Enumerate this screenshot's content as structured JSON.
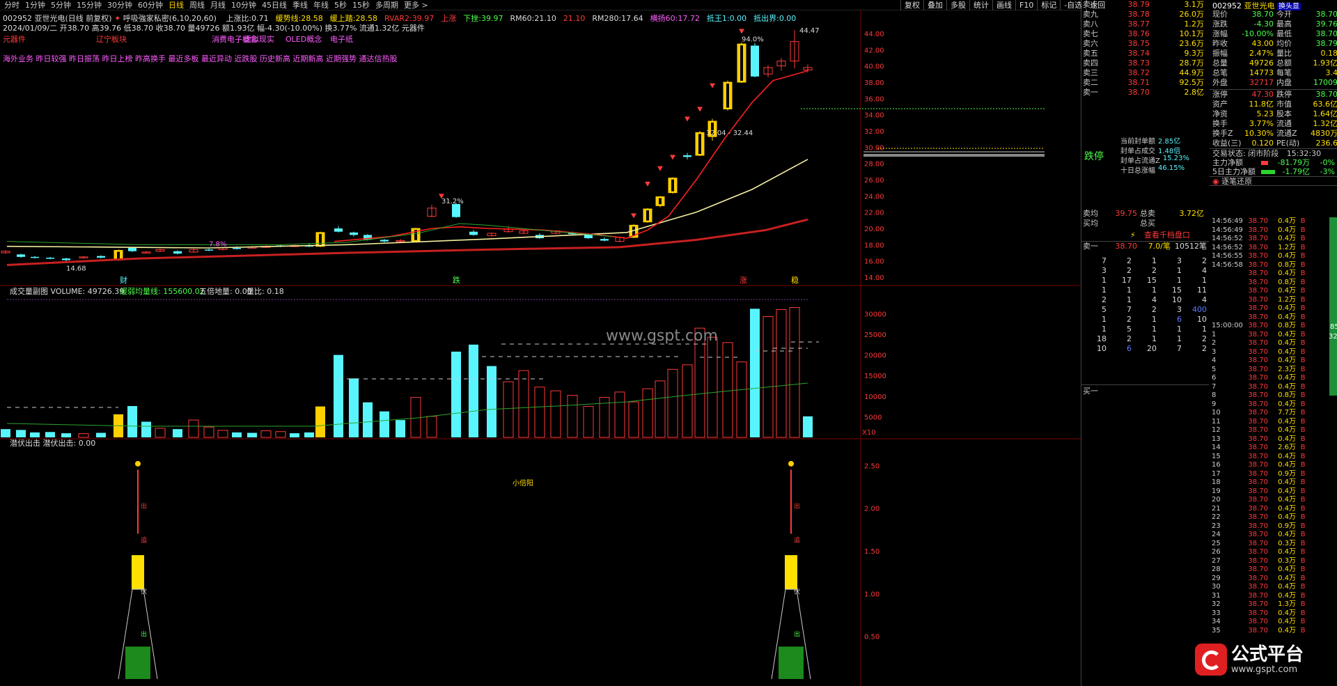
{
  "menu": {
    "periods": [
      "分时",
      "1分钟",
      "5分钟",
      "15分钟",
      "30分钟",
      "60分钟",
      "日线",
      "周线",
      "月线",
      "10分钟",
      "45日线",
      "季线",
      "年线",
      "5秒",
      "15秒",
      "多周期",
      "更多 >"
    ],
    "active": "日线",
    "tools": [
      "复权",
      "叠加",
      "多股",
      "统计",
      "画线",
      "F10",
      "标记",
      "-自选",
      "返回"
    ]
  },
  "header": {
    "code_name": "002952 亚世光电(日线 前复权)",
    "indicator": "呼吸強家私密(6,10,20,60)",
    "items": [
      {
        "label": "上涨比:",
        "value": "0.71",
        "c": "c-w"
      },
      {
        "label": "缓势线:",
        "value": "28.58",
        "c": "c-y"
      },
      {
        "label": "缓上踏:",
        "value": "28.58",
        "c": "c-y"
      },
      {
        "label": "RVAR2:",
        "value": "39.97",
        "c": "c-r"
      },
      {
        "label": "上涨",
        "value": "",
        "c": "c-r"
      },
      {
        "label": "下挫:",
        "value": "39.97",
        "c": "c-g"
      },
      {
        "label": "RM60:",
        "value": "21.10",
        "c": "c-w"
      },
      {
        "label": "",
        "value": "21.10",
        "c": "c-r"
      },
      {
        "label": "RM280:",
        "value": "17.64",
        "c": "c-w"
      },
      {
        "label": "横扬60:",
        "value": "17.72",
        "c": "c-m"
      },
      {
        "label": "抵王1:",
        "value": "0.00",
        "c": "c-c"
      },
      {
        "label": "抵出界:",
        "value": "0.00",
        "c": "c-c"
      }
    ],
    "line2": "2024/01/09/二 开38.70 高39.76 低38.70 收38.70 量49726 额1.93亿 幅-4.30(-10.00%) 换3.77% 流通1.32亿 元器件",
    "line3": [
      "元器件",
      "辽宁板块",
      "消费电子概念",
      "虚拟现实",
      "OLED概念",
      "电子纸"
    ],
    "line4": "海外业务 昨日较强 昨日振荡 昨日上榜 昨高换手 最近多板 最近异动 近跌股 历史新高 近期新高 近期强势 通达信热股"
  },
  "price_axis": [
    "44.00",
    "42.00",
    "40.00",
    "38.00",
    "36.00",
    "34.00",
    "32.00",
    "30.00",
    "28.00",
    "26.00",
    "24.00",
    "22.00",
    "20.00",
    "18.00",
    "16.00",
    "14.00"
  ],
  "annotations": {
    "top": "44.47",
    "pct1": "94.0%",
    "pct2": "31.2%",
    "pct3": "7.8%",
    "range": "32.04 - 32.44",
    "tags": [
      "财",
      "跌",
      "涨",
      "稳"
    ],
    "low": "14.68"
  },
  "volume": {
    "title": "成交量副图 VOLUME: 49726.39",
    "ma_label": "缓弱均量线: 155600.02",
    "five": "五倍地量: 0.00",
    "ratio": "量比: 0.18",
    "axis": [
      "30000",
      "25000",
      "20000",
      "15000",
      "10000",
      "5000"
    ],
    "unit": "X10",
    "note": "小倍阳"
  },
  "lower": {
    "title": "潜伏出击 潜伏出击: 0.00",
    "axis": [
      "2.50",
      "2.00",
      "1.50",
      "1.00",
      "0.50"
    ],
    "labels": [
      "出",
      "追",
      "伏",
      "出"
    ]
  },
  "orderbook": {
    "rows": [
      {
        "label": "卖十",
        "price": "38.79",
        "vol": "3.1万"
      },
      {
        "label": "卖九",
        "price": "38.78",
        "vol": "26.0万"
      },
      {
        "label": "卖八",
        "price": "38.77",
        "vol": "1.2万"
      },
      {
        "label": "卖七",
        "price": "38.76",
        "vol": "10.1万"
      },
      {
        "label": "卖六",
        "price": "38.75",
        "vol": "23.6万"
      },
      {
        "label": "卖五",
        "price": "38.74",
        "vol": "9.3万"
      },
      {
        "label": "卖四",
        "price": "38.73",
        "vol": "28.7万"
      },
      {
        "label": "卖三",
        "price": "38.72",
        "vol": "44.9万"
      },
      {
        "label": "卖二",
        "price": "38.71",
        "vol": "92.5万"
      },
      {
        "label": "卖一",
        "price": "38.70",
        "vol": "2.8亿"
      }
    ],
    "limit": "跌停",
    "seal": [
      {
        "l": "当前封单额",
        "v": "2.85亿"
      },
      {
        "l": "封单占成交",
        "v": "1.48倍"
      },
      {
        "l": "封单占流通Z",
        "v": "15.23%"
      },
      {
        "l": "十日总涨幅",
        "v": "46.15%"
      }
    ],
    "avg_sell_l": "卖均",
    "avg_sell": "39.75",
    "total_sell_l": "总卖",
    "total_sell": "3.72亿",
    "avg_buy_l": "买均",
    "total_buy_l": "总买",
    "view_btn": "查看千档盘口",
    "level_l": "卖一",
    "level_p": "38.70",
    "level_v": "7.0/笔",
    "level_n": "10512笔",
    "buy1": "买一"
  },
  "quote": {
    "code": "002952",
    "name": "亚世光电",
    "badge": "换头显",
    "rows": [
      [
        "现价",
        "38.70",
        "今开",
        "38.70"
      ],
      [
        "涨跌",
        "-4.30",
        "最高",
        "39.76"
      ],
      [
        "涨幅",
        "-10.00%",
        "最低",
        "38.70"
      ],
      [
        "昨收",
        "43.00",
        "均价",
        "38.79"
      ],
      [
        "振幅",
        "2.47%",
        "量比",
        "0.18"
      ],
      [
        "总量",
        "49726",
        "总额",
        "1.93亿"
      ],
      [
        "总笔",
        "14773",
        "每笔",
        "3.4"
      ],
      [
        "外盘",
        "32717",
        "内盘",
        "17009"
      ]
    ],
    "rows2": [
      [
        "涨停",
        "47.30",
        "跌停",
        "38.70"
      ],
      [
        "资产",
        "11.8亿",
        "市值",
        "63.6亿"
      ],
      [
        "净资",
        "5.23",
        "股本",
        "1.64亿"
      ],
      [
        "换手",
        "3.77%",
        "流通",
        "1.32亿"
      ],
      [
        "换手Z",
        "10.30%",
        "流通Z",
        "4830万"
      ],
      [
        "收益(三)",
        "0.120",
        "PE(动)",
        "236.6"
      ]
    ],
    "status": "交易状态: 闭市阶段",
    "time": "15:32:30",
    "flow1_l": "主力净额",
    "flow1": "-81.79万",
    "flow1p": "-0%",
    "flow2_l": "5日主力净额",
    "flow2": "-1.79亿",
    "flow2p": "-3%",
    "ticks_title": "逐笔还原"
  },
  "ticks": [
    [
      "14:56:49",
      "38.70",
      "0.4万",
      "B"
    ],
    [
      "14:56:49",
      "38.70",
      "0.4万",
      "B"
    ],
    [
      "14:56:52",
      "38.70",
      "0.4万",
      "B"
    ],
    [
      "14:56:52",
      "38.70",
      "1.2万",
      "B"
    ],
    [
      "14:56:55",
      "38.70",
      "0.4万",
      "B"
    ],
    [
      "14:56:58",
      "38.70",
      "0.8万",
      "B"
    ],
    [
      "",
      "38.70",
      "0.4万",
      "B"
    ],
    [
      "",
      "38.70",
      "0.8万",
      "B"
    ],
    [
      "",
      "38.70",
      "0.4万",
      "B"
    ],
    [
      "",
      "38.70",
      "1.2万",
      "B"
    ],
    [
      "",
      "38.70",
      "0.4万",
      "B"
    ],
    [
      "",
      "38.70",
      "0.4万",
      "B"
    ],
    [
      "15:00:00",
      "38.70",
      "0.8万",
      "B"
    ],
    [
      "1",
      "38.70",
      "0.4万",
      "B"
    ],
    [
      "2",
      "38.70",
      "0.4万",
      "B"
    ],
    [
      "3",
      "38.70",
      "0.4万",
      "B"
    ],
    [
      "4",
      "38.70",
      "0.4万",
      "B"
    ],
    [
      "5",
      "38.70",
      "2.3万",
      "B"
    ],
    [
      "6",
      "38.70",
      "0.4万",
      "B"
    ],
    [
      "7",
      "38.70",
      "0.4万",
      "B"
    ],
    [
      "8",
      "38.70",
      "0.8万",
      "B"
    ],
    [
      "9",
      "38.70",
      "0.4万",
      "B"
    ],
    [
      "10",
      "38.70",
      "7.7万",
      "B"
    ],
    [
      "11",
      "38.70",
      "0.4万",
      "B"
    ],
    [
      "12",
      "38.70",
      "0.4万",
      "B"
    ],
    [
      "13",
      "38.70",
      "0.4万",
      "B"
    ],
    [
      "14",
      "38.70",
      "2.6万",
      "B"
    ],
    [
      "15",
      "38.70",
      "0.4万",
      "B"
    ],
    [
      "16",
      "38.70",
      "0.4万",
      "B"
    ],
    [
      "17",
      "38.70",
      "0.9万",
      "B"
    ],
    [
      "18",
      "38.70",
      "0.4万",
      "B"
    ],
    [
      "19",
      "38.70",
      "0.4万",
      "B"
    ],
    [
      "20",
      "38.70",
      "0.4万",
      "B"
    ],
    [
      "21",
      "38.70",
      "0.4万",
      "B"
    ],
    [
      "22",
      "38.70",
      "0.4万",
      "B"
    ],
    [
      "23",
      "38.70",
      "0.9万",
      "B"
    ],
    [
      "24",
      "38.70",
      "0.4万",
      "B"
    ],
    [
      "25",
      "38.70",
      "0.3万",
      "B"
    ],
    [
      "26",
      "38.70",
      "0.4万",
      "B"
    ],
    [
      "27",
      "38.70",
      "0.3万",
      "B"
    ],
    [
      "28",
      "38.70",
      "0.4万",
      "B"
    ],
    [
      "29",
      "38.70",
      "0.4万",
      "B"
    ],
    [
      "30",
      "38.70",
      "0.4万",
      "B"
    ],
    [
      "31",
      "38.70",
      "0.4万",
      "B"
    ],
    [
      "32",
      "38.70",
      "1.3万",
      "B"
    ],
    [
      "33",
      "38.70",
      "0.4万",
      "B"
    ],
    [
      "34",
      "38.70",
      "0.4万",
      "B"
    ],
    [
      "35",
      "38.70",
      "0.4万",
      "B"
    ]
  ],
  "tradeblock": [
    [
      "7",
      "2",
      "1",
      "3",
      "2"
    ],
    [
      "3",
      "2",
      "2",
      "1",
      "4"
    ],
    [
      "1",
      "17",
      "15",
      "1",
      "1"
    ],
    [
      "1",
      "1",
      "1",
      "15",
      "11"
    ],
    [
      "2",
      "1",
      "4",
      "10",
      "4"
    ],
    [
      "5",
      "7",
      "2",
      "3",
      "400"
    ],
    [
      "1",
      "2",
      "1",
      "6",
      "10"
    ],
    [
      "1",
      "5",
      "1",
      "1",
      "1"
    ],
    [
      "18",
      "2",
      "1",
      "1",
      "2"
    ],
    [
      "10",
      "6",
      "20",
      "7",
      "2"
    ]
  ],
  "logo": {
    "name": "公式平台",
    "url": "www.gspt.com"
  },
  "watermark": "www.gspt.com"
}
